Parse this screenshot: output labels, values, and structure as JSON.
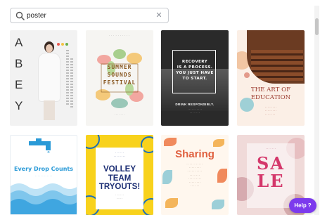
{
  "search": {
    "value": "poster",
    "placeholder": ""
  },
  "cards": {
    "abey": {
      "letters": [
        "A",
        "B",
        "E",
        "Y"
      ]
    },
    "summer": {
      "title": [
        "SUMMER",
        "SOUNDS",
        "FESTIVAL"
      ]
    },
    "recovery": {
      "title": [
        "RECOVERY",
        "IS A PROCESS.",
        "YOU JUST HAVE",
        "TO START."
      ],
      "footer": "DRINK RESPONSIBLY."
    },
    "art": {
      "title": [
        "THE ART OF",
        "EDUCATION"
      ]
    },
    "drop": {
      "title": "Every Drop Counts"
    },
    "volley": {
      "title": [
        "VOLLEY",
        "TEAM",
        "TRYOUTS!"
      ]
    },
    "sharing": {
      "title": "Sharing"
    },
    "sale": {
      "title": [
        "SA",
        "LE"
      ]
    }
  },
  "help": {
    "label": "Help",
    "icon": "?"
  },
  "colors": {
    "accent": "#7c3aed",
    "summer": "#8a5a24",
    "art": "#9b3a2e",
    "drop": "#2a9ad7",
    "volley": "#1b2d73",
    "sharing": "#e0603f",
    "sale": "#d4386b"
  }
}
